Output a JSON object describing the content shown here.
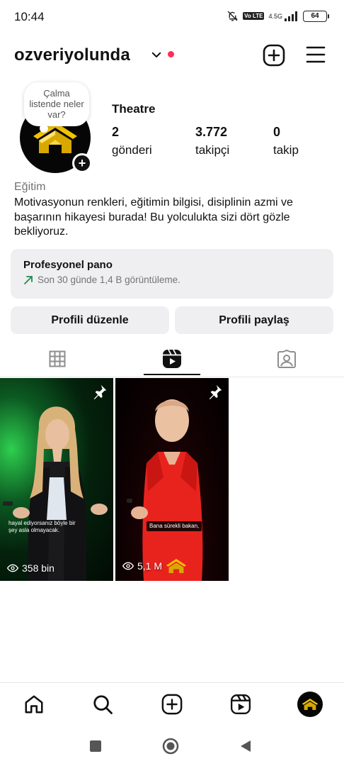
{
  "status_bar": {
    "time": "10:44",
    "network": "4.5G",
    "lte_badge": "Vo LTE",
    "battery": "64"
  },
  "header": {
    "username": "ozveriyolunda",
    "icons": [
      "chevron-down-icon",
      "notification-dot",
      "create-post-icon",
      "menu-icon"
    ]
  },
  "profile": {
    "note": "Çalma listende neler var?",
    "category_top": "Theatre",
    "stats": [
      {
        "value": "2",
        "label": "gönderi"
      },
      {
        "value": "3.772",
        "label": "takipçi"
      },
      {
        "value": "0",
        "label": "takip"
      }
    ],
    "category": "Eğitim",
    "bio": "Motivasyonun renkleri, eğitimin bilgisi, disiplinin azmi ve başarının hikayesi burada! Bu yolculukta sizi dört gözle bekliyoruz."
  },
  "professional": {
    "title": "Profesyonel pano",
    "subtitle": "Son 30 günde 1,4 B görüntüleme."
  },
  "buttons": {
    "edit": "Profili düzenle",
    "share": "Profili paylaş"
  },
  "tabs": [
    "grid-tab",
    "reels-tab",
    "tagged-tab"
  ],
  "posts": [
    {
      "views": "358 bin",
      "caption": "hayal ediyorsanız böyle bir şey asla olmayacak.",
      "pinned": true
    },
    {
      "views": "5,1 M",
      "caption": "Bana sürekli bakan,",
      "pinned": true
    }
  ],
  "colors": {
    "accent_red": "#ff2d55",
    "panel_bg": "#efeff1",
    "muted_text": "#737373",
    "logo_gold": "#f2c200"
  }
}
